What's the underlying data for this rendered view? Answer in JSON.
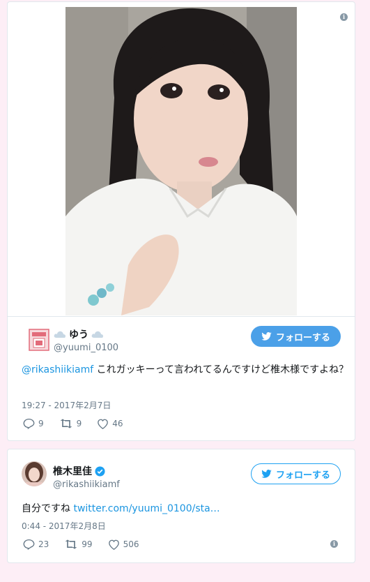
{
  "tweet1": {
    "display_name": "ゆう",
    "handle": "@yuumi_0100",
    "follow_label": "フォローする",
    "mention": "@rikashiikiamf",
    "text": " これガッキーって言われてるんですけど椎木様ですよね？",
    "timestamp": "19:27 - 2017年2月7日",
    "replies": "9",
    "retweets": "9",
    "likes": "46"
  },
  "tweet2": {
    "display_name": "椎木里佳",
    "handle": "@rikashiikiamf",
    "follow_label": "フォローする",
    "text": "自分ですね ",
    "link": "twitter.com/yuumi_0100/sta…",
    "timestamp": "0:44 - 2017年2月8日",
    "replies": "23",
    "retweets": "99",
    "likes": "506"
  },
  "colors": {
    "background": "#fdeef6",
    "twitter_blue": "#1da1f2",
    "link": "#1b95e0",
    "muted": "#657786"
  },
  "icons": {
    "info": "info-icon",
    "verified": "verified-badge-icon",
    "cloud": "cloud-icon",
    "bird": "twitter-bird-icon",
    "reply": "reply-icon",
    "retweet": "retweet-icon",
    "like": "heart-icon"
  }
}
